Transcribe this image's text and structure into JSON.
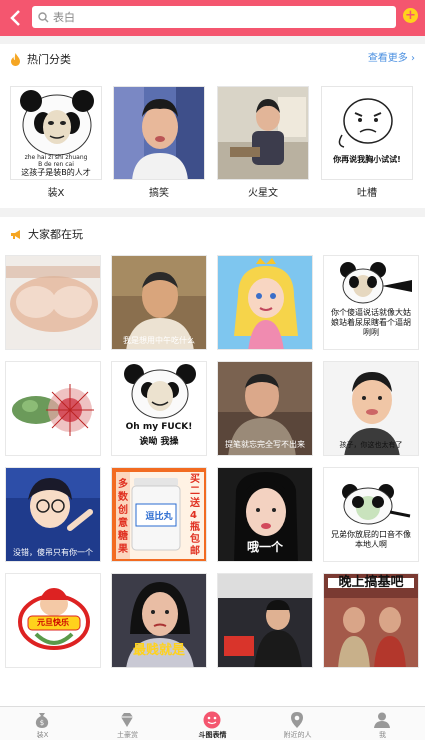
{
  "search": {
    "placeholder": "表白"
  },
  "hot": {
    "title": "热门分类",
    "more": "查看更多"
  },
  "categories": [
    {
      "label": "装X",
      "caption_top": "zhe hai zi shi zhuang",
      "caption_mid": "B de ren cai",
      "caption_bottom": "这孩子是装B的人才"
    },
    {
      "label": "搞笑"
    },
    {
      "label": "火星文"
    },
    {
      "label": "吐槽",
      "caption": "你再说我胸小试试!"
    }
  ],
  "playing": {
    "title": "大家都在玩"
  },
  "grid": [
    {
      "caption": ""
    },
    {
      "caption": "我是想用中午吃什么"
    },
    {
      "caption": ""
    },
    {
      "caption": "你个傻逼说话就像大姑娘站着尿尿瞎看个逼胡咧咧"
    },
    {
      "caption": ""
    },
    {
      "caption_top": "Oh my FUCK!",
      "caption": "诶呦 我操"
    },
    {
      "caption": "提笔就忘完全写不出来"
    },
    {
      "caption": "孩子，你这也太有了"
    },
    {
      "caption": "没错，傻吊只有你一个"
    },
    {
      "caption": "逗比丸",
      "left_text": "多数创意糖果",
      "right_text": "买二送4瓶包邮"
    },
    {
      "caption": "哦一个"
    },
    {
      "caption": "兄弟你放屁的口音不像本地人啊"
    },
    {
      "caption": "元旦快乐"
    },
    {
      "caption": "最贱就是"
    },
    {
      "caption": ""
    },
    {
      "caption": "晚上搞基吧"
    }
  ],
  "tabs": [
    {
      "label": "装X"
    },
    {
      "label": "土豪赏"
    },
    {
      "label": "斗图表情"
    },
    {
      "label": "附近的人"
    },
    {
      "label": "我"
    }
  ],
  "colors": {
    "accent": "#f4566f",
    "link": "#4a8fe0",
    "badge": "#ffd21c"
  }
}
